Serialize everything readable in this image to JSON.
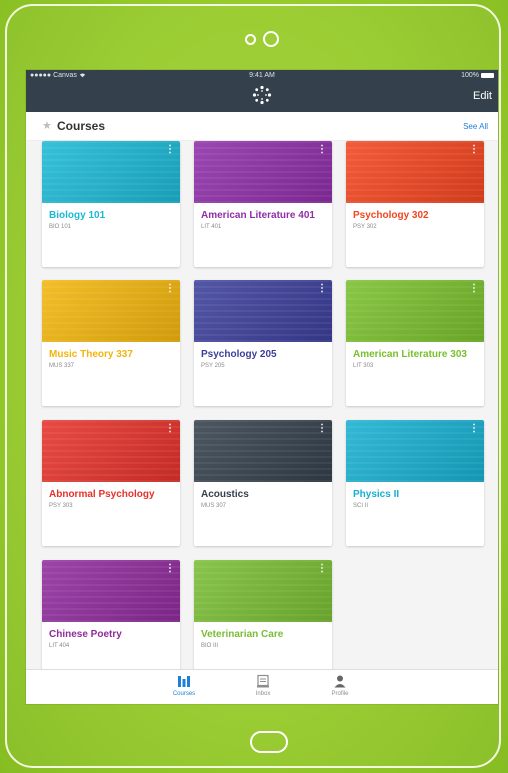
{
  "status_bar": {
    "carrier": "●●●●● Canvas",
    "wifi": "wifi-icon",
    "time": "9:41 AM",
    "battery": "100%"
  },
  "header": {
    "logo": "canvas-logo-icon",
    "edit_label": "Edit"
  },
  "courses_section": {
    "title": "Courses",
    "see_all_label": "See All",
    "star": "star-icon"
  },
  "courses": [
    {
      "title": "Biology 101",
      "code": "BIO 101",
      "color": "#1bb8d4"
    },
    {
      "title": "American Literature 401",
      "code": "LIT 401",
      "color": "#8e2ea8"
    },
    {
      "title": "Psychology 302",
      "code": "PSY 302",
      "color": "#f2451f"
    },
    {
      "title": "Music Theory 337",
      "code": "MUS 337",
      "color": "#f2b50c"
    },
    {
      "title": "Psychology 205",
      "code": "PSY 205",
      "color": "#3c3f9a"
    },
    {
      "title": "American Literature 303",
      "code": "LIT 303",
      "color": "#79bf2c"
    },
    {
      "title": "Abnormal Psychology",
      "code": "PSY 303",
      "color": "#e4322a"
    },
    {
      "title": "Acoustics",
      "code": "MUS 307",
      "color": "#34404c"
    },
    {
      "title": "Physics II",
      "code": "SCI II",
      "color": "#17afd0"
    },
    {
      "title": "Chinese Poetry",
      "code": "LIT 404",
      "color": "#8f2b9c"
    },
    {
      "title": "Veterinarian Care",
      "code": "BIO III",
      "color": "#78bd33"
    }
  ],
  "tabbar": [
    {
      "label": "Courses",
      "icon": "courses-icon",
      "active": true
    },
    {
      "label": "Inbox",
      "icon": "inbox-icon",
      "active": false
    },
    {
      "label": "Profile",
      "icon": "profile-icon",
      "active": false
    }
  ]
}
